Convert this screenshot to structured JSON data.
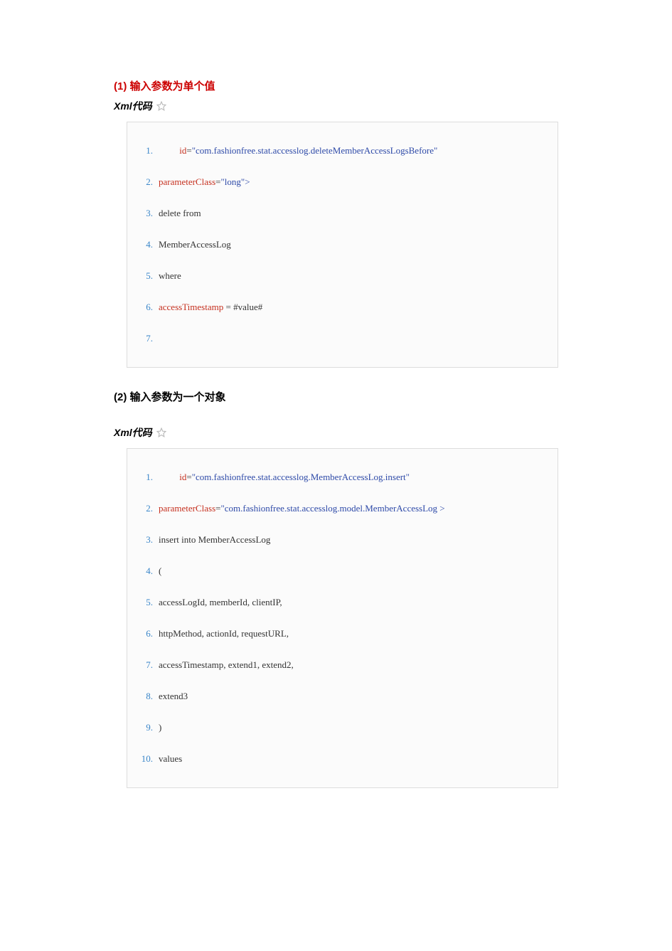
{
  "sections": [
    {
      "title": "(1) 输入参数为单个值",
      "title_class": "heading-1",
      "label": "Xml代码",
      "lines": [
        {
          "n": "1.",
          "segs": [
            {
              "t": "         ",
              "c": "txt"
            },
            {
              "t": "id",
              "c": "attr"
            },
            {
              "t": "=",
              "c": "txt"
            },
            {
              "t": "\"com.fashionfree.stat.accesslog.deleteMemberAccessLogsBefore\"",
              "c": "val"
            }
          ]
        },
        {
          "n": "2.",
          "segs": [
            {
              "t": "parameterClass",
              "c": "attr"
            },
            {
              "t": "=",
              "c": "txt"
            },
            {
              "t": "\"long\"",
              "c": "val"
            },
            {
              "t": ">",
              "c": "tagc"
            }
          ]
        },
        {
          "n": "3.",
          "segs": [
            {
              "t": "delete from",
              "c": "txt"
            }
          ]
        },
        {
          "n": "4.",
          "segs": [
            {
              "t": "MemberAccessLog",
              "c": "txt"
            }
          ]
        },
        {
          "n": "5.",
          "segs": [
            {
              "t": "where",
              "c": "txt"
            }
          ]
        },
        {
          "n": "6.",
          "segs": [
            {
              "t": "accessTimestamp",
              "c": "attr"
            },
            {
              "t": " = #value#",
              "c": "txt"
            }
          ]
        },
        {
          "n": "7.",
          "segs": []
        }
      ]
    },
    {
      "title": "(2) 输入参数为一个对象",
      "title_class": "heading-2",
      "label": "Xml代码",
      "lines": [
        {
          "n": "1.",
          "segs": [
            {
              "t": "         ",
              "c": "txt"
            },
            {
              "t": "id",
              "c": "attr"
            },
            {
              "t": "=",
              "c": "txt"
            },
            {
              "t": "\"com.fashionfree.stat.accesslog.MemberAccessLog.insert\"",
              "c": "val"
            }
          ]
        },
        {
          "n": "2.",
          "segs": [
            {
              "t": "parameterClass",
              "c": "attr"
            },
            {
              "t": "=",
              "c": "txt"
            },
            {
              "t": "\"com.fashionfree.stat.accesslog.model.MemberAccessLog",
              "c": "val"
            },
            {
              "t": " >",
              "c": "tagc"
            }
          ]
        },
        {
          "n": "3.",
          "segs": [
            {
              "t": "insert into MemberAccessLog",
              "c": "txt"
            }
          ]
        },
        {
          "n": "4.",
          "segs": [
            {
              "t": "(",
              "c": "txt"
            }
          ]
        },
        {
          "n": "5.",
          "segs": [
            {
              "t": "accessLogId, memberId, clientIP,",
              "c": "txt"
            }
          ]
        },
        {
          "n": "6.",
          "segs": [
            {
              "t": "httpMethod, actionId, requestURL,",
              "c": "txt"
            }
          ]
        },
        {
          "n": "7.",
          "segs": [
            {
              "t": "accessTimestamp, extend1, extend2,",
              "c": "txt"
            }
          ]
        },
        {
          "n": "8.",
          "segs": [
            {
              "t": "extend3",
              "c": "txt"
            }
          ]
        },
        {
          "n": "9.",
          "segs": [
            {
              "t": ")",
              "c": "txt"
            }
          ]
        },
        {
          "n": "10.",
          "segs": [
            {
              "t": "values",
              "c": "txt"
            }
          ]
        }
      ]
    }
  ]
}
